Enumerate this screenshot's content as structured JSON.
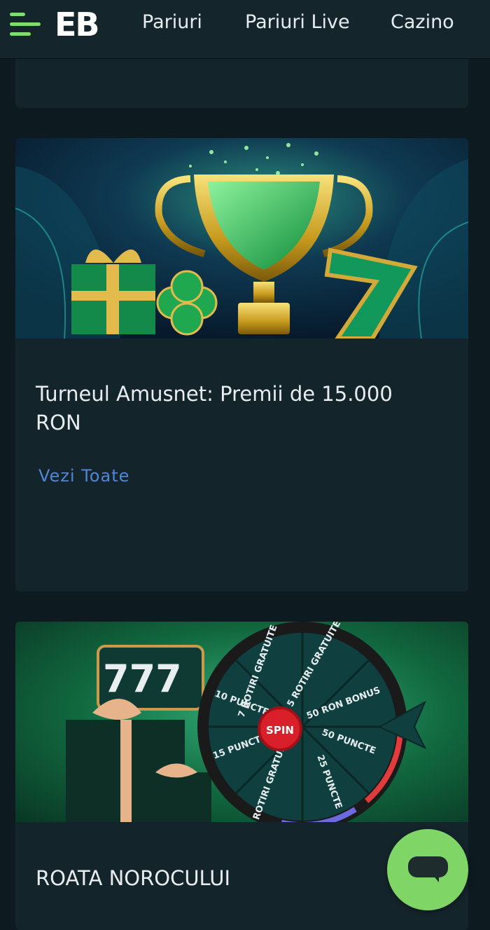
{
  "header": {
    "logo": "EB",
    "nav": [
      "Pariuri",
      "Pariuri Live",
      "Cazino"
    ]
  },
  "tournament": {
    "title": "Turneul Amusnet: Premii de 15.000 RON",
    "link": "Vezi Toate"
  },
  "wheel": {
    "title": "ROATA NOROCULUI",
    "center_label": "SPIN",
    "slot_digits": "777",
    "segments": [
      "7 ROTIRI GRATUITE",
      "5 ROTIRI GRATUITE",
      "50 RON BONUS",
      "50 PUNCTE",
      "25 PUNCTE",
      "20 ROTIRI GRATUITE",
      "15 PUNCTE",
      "10 PUNCTE"
    ]
  },
  "icons": {
    "menu": "hamburger-menu-icon",
    "chat": "chat-bubble-icon"
  },
  "colors": {
    "accent_green": "#7fd667",
    "link_blue": "#4f86d6",
    "background": "#0d1a1f",
    "card": "#14242b"
  }
}
